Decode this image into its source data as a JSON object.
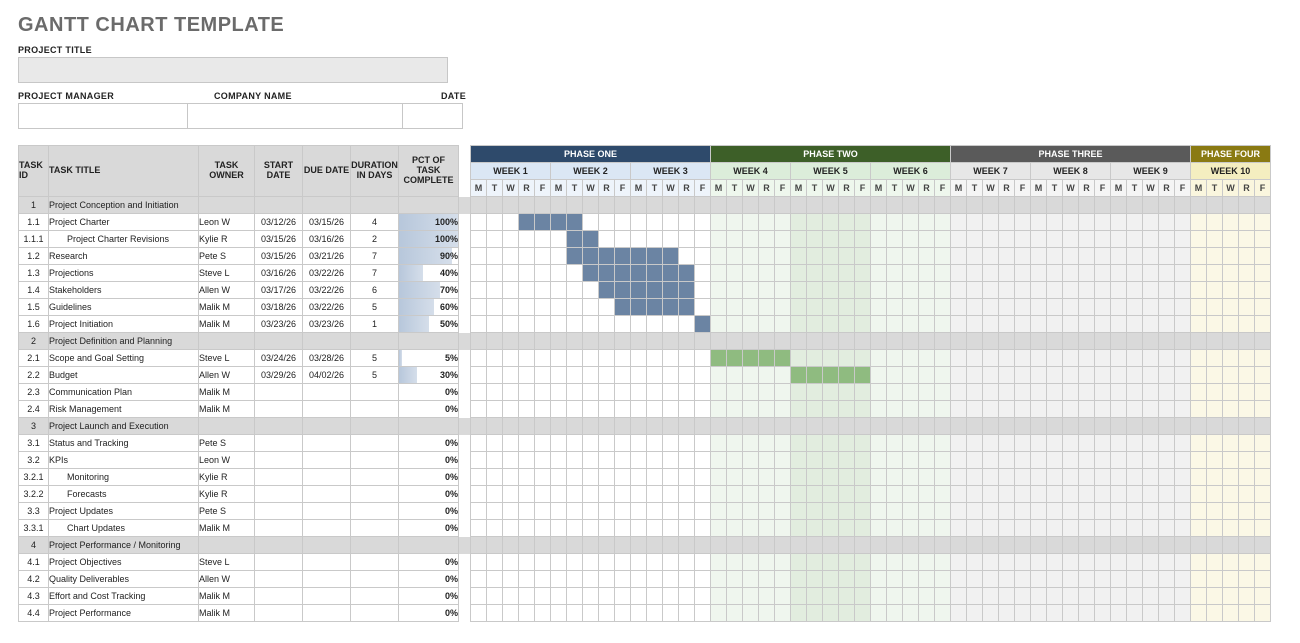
{
  "chart_data": {
    "type": "gantt",
    "title": "GANTT CHART TEMPLATE",
    "phases": [
      {
        "name": "PHASE ONE",
        "weeks": [
          "WEEK 1",
          "WEEK 2",
          "WEEK 3"
        ]
      },
      {
        "name": "PHASE TWO",
        "weeks": [
          "WEEK 4",
          "WEEK 5",
          "WEEK 6"
        ]
      },
      {
        "name": "PHASE THREE",
        "weeks": [
          "WEEK 7",
          "WEEK 8",
          "WEEK 9"
        ]
      },
      {
        "name": "PHASE FOUR",
        "weeks": [
          "WEEK 10"
        ]
      }
    ],
    "day_labels": [
      "M",
      "T",
      "W",
      "R",
      "F"
    ],
    "tasks": [
      {
        "id": "1",
        "title": "Project Conception and Initiation",
        "section": true
      },
      {
        "id": "1.1",
        "title": "Project Charter",
        "owner": "Leon W",
        "start": "03/12/26",
        "due": "03/15/26",
        "duration": 4,
        "pct": 100,
        "bar_phase": 1,
        "bar_start_day": 3,
        "bar_len": 4
      },
      {
        "id": "1.1.1",
        "title": "Project Charter Revisions",
        "owner": "Kylie R",
        "start": "03/15/26",
        "due": "03/16/26",
        "duration": 2,
        "pct": 100,
        "bar_phase": 1,
        "bar_start_day": 6,
        "bar_len": 2,
        "indent": 1
      },
      {
        "id": "1.2",
        "title": "Research",
        "owner": "Pete S",
        "start": "03/15/26",
        "due": "03/21/26",
        "duration": 7,
        "pct": 90,
        "bar_phase": 1,
        "bar_start_day": 6,
        "bar_len": 7
      },
      {
        "id": "1.3",
        "title": "Projections",
        "owner": "Steve L",
        "start": "03/16/26",
        "due": "03/22/26",
        "duration": 7,
        "pct": 40,
        "bar_phase": 1,
        "bar_start_day": 7,
        "bar_len": 7
      },
      {
        "id": "1.4",
        "title": "Stakeholders",
        "owner": "Allen W",
        "start": "03/17/26",
        "due": "03/22/26",
        "duration": 6,
        "pct": 70,
        "bar_phase": 1,
        "bar_start_day": 8,
        "bar_len": 6
      },
      {
        "id": "1.5",
        "title": "Guidelines",
        "owner": "Malik M",
        "start": "03/18/26",
        "due": "03/22/26",
        "duration": 5,
        "pct": 60,
        "bar_phase": 1,
        "bar_start_day": 9,
        "bar_len": 5
      },
      {
        "id": "1.6",
        "title": "Project Initiation",
        "owner": "Malik M",
        "start": "03/23/26",
        "due": "03/23/26",
        "duration": 1,
        "pct": 50,
        "bar_phase": 1,
        "bar_start_day": 14,
        "bar_len": 1
      },
      {
        "id": "2",
        "title": "Project Definition and Planning",
        "section": true
      },
      {
        "id": "2.1",
        "title": "Scope and Goal Setting",
        "owner": "Steve L",
        "start": "03/24/26",
        "due": "03/28/26",
        "duration": 5,
        "pct": 5,
        "bar_phase": 2,
        "bar_start_day": 0,
        "bar_len": 5
      },
      {
        "id": "2.2",
        "title": "Budget",
        "owner": "Allen W",
        "start": "03/29/26",
        "due": "04/02/26",
        "duration": 5,
        "pct": 30,
        "bar_phase": 2,
        "bar_start_day": 5,
        "bar_len": 5
      },
      {
        "id": "2.3",
        "title": "Communication Plan",
        "owner": "Malik M",
        "pct": 0
      },
      {
        "id": "2.4",
        "title": "Risk Management",
        "owner": "Malik M",
        "pct": 0
      },
      {
        "id": "3",
        "title": "Project Launch and Execution",
        "section": true
      },
      {
        "id": "3.1",
        "title": "Status and Tracking",
        "owner": "Pete S",
        "pct": 0
      },
      {
        "id": "3.2",
        "title": "KPIs",
        "owner": "Leon W",
        "pct": 0
      },
      {
        "id": "3.2.1",
        "title": "Monitoring",
        "owner": "Kylie R",
        "pct": 0,
        "indent": 1
      },
      {
        "id": "3.2.2",
        "title": "Forecasts",
        "owner": "Kylie R",
        "pct": 0,
        "indent": 1
      },
      {
        "id": "3.3",
        "title": "Project Updates",
        "owner": "Pete S",
        "pct": 0
      },
      {
        "id": "3.3.1",
        "title": "Chart Updates",
        "owner": "Malik M",
        "pct": 0,
        "indent": 1
      },
      {
        "id": "4",
        "title": "Project Performance / Monitoring",
        "section": true
      },
      {
        "id": "4.1",
        "title": "Project Objectives",
        "owner": "Steve L",
        "pct": 0
      },
      {
        "id": "4.2",
        "title": "Quality Deliverables",
        "owner": "Allen W",
        "pct": 0
      },
      {
        "id": "4.3",
        "title": "Effort and Cost Tracking",
        "owner": "Malik M",
        "pct": 0
      },
      {
        "id": "4.4",
        "title": "Project Performance",
        "owner": "Malik M",
        "pct": 0
      }
    ]
  },
  "header": {
    "title": "GANTT CHART TEMPLATE",
    "labels": {
      "project_title": "PROJECT TITLE",
      "project_manager": "PROJECT MANAGER",
      "company_name": "COMPANY NAME",
      "date": "DATE"
    },
    "values": {
      "project_title": "",
      "project_manager": "",
      "company_name": "",
      "date": ""
    }
  },
  "columns": {
    "task_id": "TASK ID",
    "task_title": "TASK TITLE",
    "task_owner": "TASK OWNER",
    "start_date": "START DATE",
    "due_date": "DUE DATE",
    "duration": "DURATION IN DAYS",
    "pct": "PCT OF TASK COMPLETE"
  }
}
